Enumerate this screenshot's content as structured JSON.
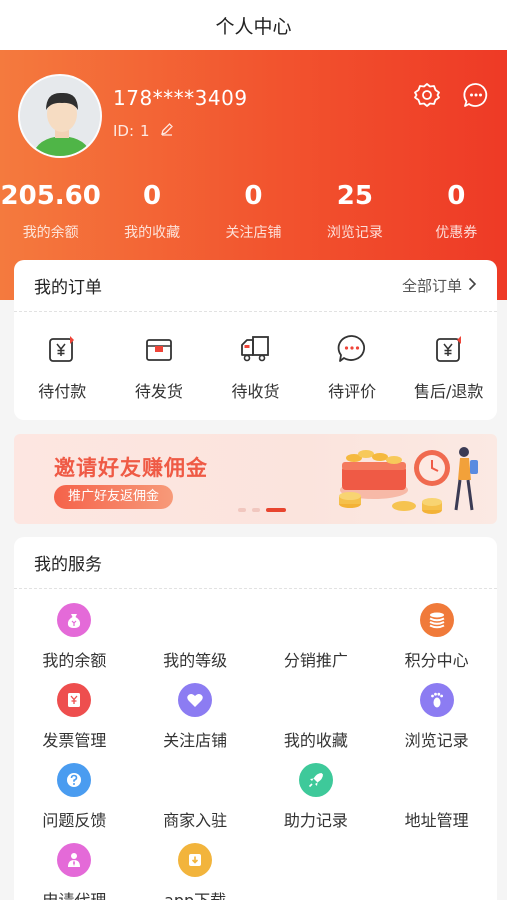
{
  "header": {
    "title": "个人中心"
  },
  "profile": {
    "phone": "178****3409",
    "id_label": "ID:",
    "id_value": "1"
  },
  "icons": {
    "settings": "gear-icon",
    "messages": "chat-bubble-icon",
    "edit": "pencil-icon"
  },
  "stats": [
    {
      "value": "205.60",
      "label": "我的余额"
    },
    {
      "value": "0",
      "label": "我的收藏"
    },
    {
      "value": "0",
      "label": "关注店铺"
    },
    {
      "value": "25",
      "label": "浏览记录"
    },
    {
      "value": "0",
      "label": "优惠券"
    }
  ],
  "orders": {
    "title": "我的订单",
    "all_label": "全部订单",
    "items": [
      {
        "label": "待付款",
        "icon": "wallet-yen-icon"
      },
      {
        "label": "待发货",
        "icon": "package-box-icon"
      },
      {
        "label": "待收货",
        "icon": "delivery-truck-icon"
      },
      {
        "label": "待评价",
        "icon": "comment-bubble-icon"
      },
      {
        "label": "售后/退款",
        "icon": "refund-yen-icon"
      }
    ]
  },
  "banner": {
    "title": "邀请好友赚佣金",
    "subtitle": "推广好友返佣金",
    "slides_total": 3,
    "active_slide": 3
  },
  "services": {
    "title": "我的服务",
    "items": [
      {
        "label": "我的余额",
        "icon": "money-bag-icon",
        "color": "#e46ad8"
      },
      {
        "label": "我的等级",
        "icon": "",
        "color": ""
      },
      {
        "label": "分销推广",
        "icon": "",
        "color": ""
      },
      {
        "label": "积分中心",
        "icon": "coin-stack-icon",
        "color": "#f07a3a"
      },
      {
        "label": "发票管理",
        "icon": "invoice-icon",
        "color": "#ee4e4e"
      },
      {
        "label": "关注店铺",
        "icon": "heart-icon",
        "color": "#8c7cf2"
      },
      {
        "label": "我的收藏",
        "icon": "",
        "color": ""
      },
      {
        "label": "浏览记录",
        "icon": "footprint-icon",
        "color": "#8c7cf2"
      },
      {
        "label": "问题反馈",
        "icon": "question-icon",
        "color": "#4a9cf0"
      },
      {
        "label": "商家入驻",
        "icon": "",
        "color": ""
      },
      {
        "label": "助力记录",
        "icon": "rocket-icon",
        "color": "#3ec99a"
      },
      {
        "label": "地址管理",
        "icon": "",
        "color": ""
      },
      {
        "label": "申请代理",
        "icon": "agent-person-icon",
        "color": "#e46ad8"
      },
      {
        "label": "app下载",
        "icon": "download-icon",
        "color": "#f2b43c"
      }
    ]
  },
  "colors": {
    "brand": "#f2532e",
    "banner_text": "#ef5a45"
  }
}
